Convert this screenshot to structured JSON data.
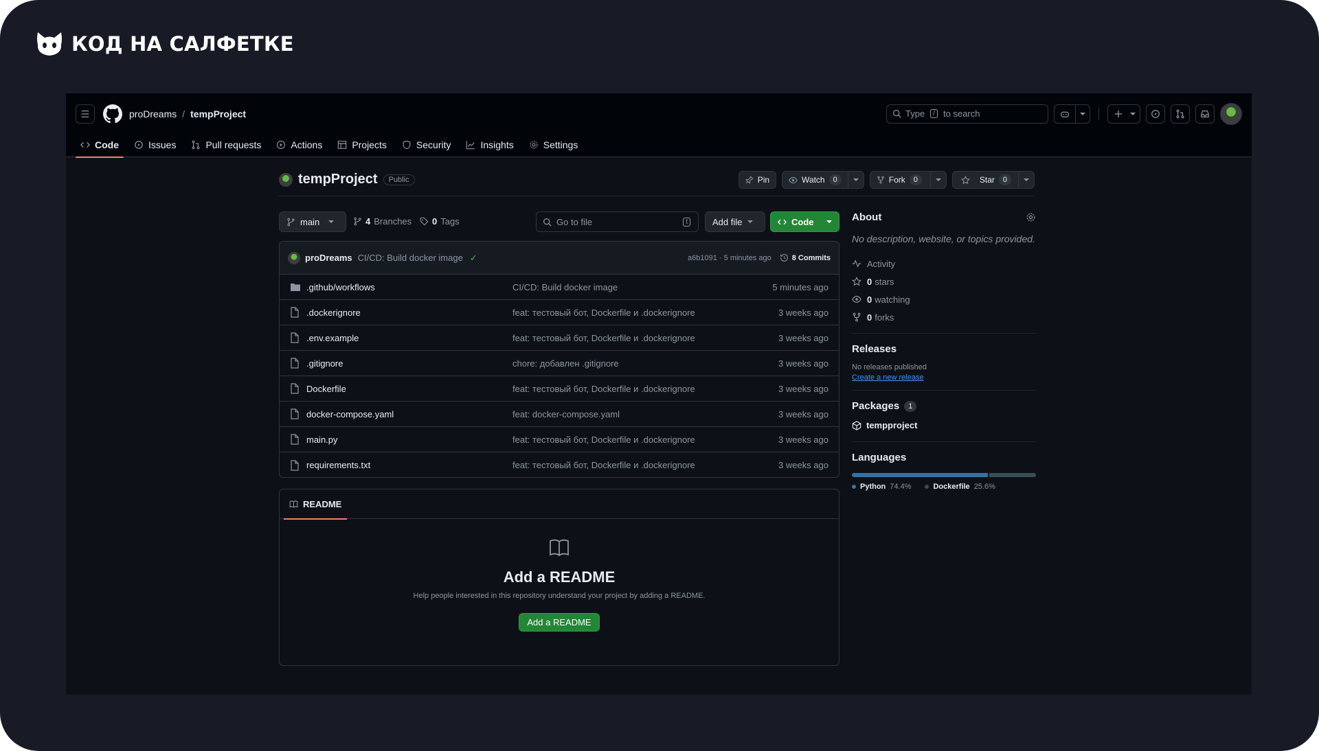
{
  "brand": {
    "text": "КОД НА САЛФЕТКЕ"
  },
  "header": {
    "owner": "proDreams",
    "separator": "/",
    "repo": "tempProject",
    "search_placeholder_pre": "Type",
    "search_key": "/",
    "search_placeholder_post": "to search"
  },
  "tabs": [
    {
      "label": "Code",
      "icon": "code-icon",
      "active": true
    },
    {
      "label": "Issues",
      "icon": "issue-icon"
    },
    {
      "label": "Pull requests",
      "icon": "pull-request-icon"
    },
    {
      "label": "Actions",
      "icon": "play-icon"
    },
    {
      "label": "Projects",
      "icon": "table-icon"
    },
    {
      "label": "Security",
      "icon": "shield-icon"
    },
    {
      "label": "Insights",
      "icon": "graph-icon"
    },
    {
      "label": "Settings",
      "icon": "gear-icon"
    }
  ],
  "repo": {
    "name": "tempProject",
    "visibility": "Public",
    "pin": "Pin",
    "watch": "Watch",
    "watch_count": "0",
    "fork": "Fork",
    "fork_count": "0",
    "star": "Star",
    "star_count": "0"
  },
  "toolbar": {
    "branch": "main",
    "branches_count": "4",
    "branches_label": "Branches",
    "tags_count": "0",
    "tags_label": "Tags",
    "goto_placeholder": "Go to file",
    "goto_key": "t",
    "add_file": "Add file",
    "code": "Code"
  },
  "commit": {
    "author": "proDreams",
    "message": "CI/CD: Build docker image",
    "check": "✓",
    "hash_time": "a6b1091 · 5 minutes ago",
    "commits": "8 Commits"
  },
  "files": [
    {
      "type": "folder",
      "name": ".github/workflows",
      "message": "CI/CD: Build docker image",
      "time": "5 minutes ago"
    },
    {
      "type": "file",
      "name": ".dockerignore",
      "message": "feat: тестовый бот, Dockerfile и .dockerignore",
      "time": "3 weeks ago"
    },
    {
      "type": "file",
      "name": ".env.example",
      "message": "feat: тестовый бот, Dockerfile и .dockerignore",
      "time": "3 weeks ago"
    },
    {
      "type": "file",
      "name": ".gitignore",
      "message": "chore: добавлен .gitignore",
      "time": "3 weeks ago"
    },
    {
      "type": "file",
      "name": "Dockerfile",
      "message": "feat: тестовый бот, Dockerfile и .dockerignore",
      "time": "3 weeks ago"
    },
    {
      "type": "file",
      "name": "docker-compose.yaml",
      "message": "feat: docker-compose.yaml",
      "time": "3 weeks ago"
    },
    {
      "type": "file",
      "name": "main.py",
      "message": "feat: тестовый бот, Dockerfile и .dockerignore",
      "time": "3 weeks ago"
    },
    {
      "type": "file",
      "name": "requirements.txt",
      "message": "feat: тестовый бот, Dockerfile и .dockerignore",
      "time": "3 weeks ago"
    }
  ],
  "readme": {
    "tab": "README",
    "title": "Add a README",
    "description": "Help people interested in this repository understand your project by adding a README.",
    "button": "Add a README"
  },
  "about": {
    "title": "About",
    "description": "No description, website, or topics provided.",
    "activity": "Activity",
    "stars_count": "0",
    "stars_label": "stars",
    "watching_count": "0",
    "watching_label": "watching",
    "forks_count": "0",
    "forks_label": "forks"
  },
  "releases": {
    "title": "Releases",
    "none": "No releases published",
    "create": "Create a new release"
  },
  "packages": {
    "title": "Packages",
    "count": "1",
    "item": "tempproject"
  },
  "languages": {
    "title": "Languages",
    "items": [
      {
        "name": "Python",
        "percent": "74.4%",
        "value": 74.4,
        "color": "#3572A5"
      },
      {
        "name": "Dockerfile",
        "percent": "25.6%",
        "value": 25.6,
        "color": "#384d54"
      }
    ]
  },
  "colors": {
    "accent_green": "#238636",
    "tab_underline": "#f78166",
    "link": "#4493f8"
  }
}
